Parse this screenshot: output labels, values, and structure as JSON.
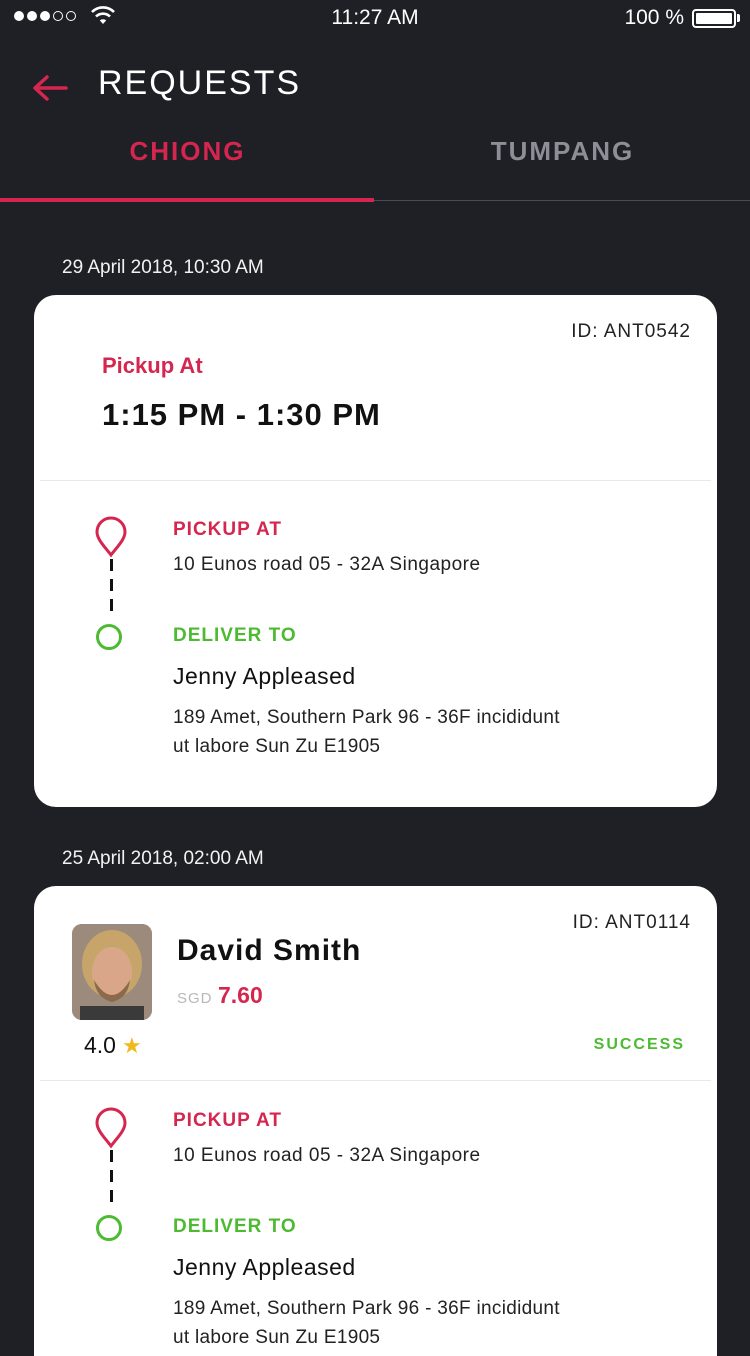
{
  "status_bar": {
    "time": "11:27 AM",
    "battery": "100 %"
  },
  "header": {
    "title": "REQUESTS"
  },
  "tabs": [
    {
      "label": "CHIONG",
      "active": true
    },
    {
      "label": "TUMPANG",
      "active": false
    }
  ],
  "requests": [
    {
      "date": "29 April 2018, 10:30 AM",
      "id": "ID: ANT0542",
      "pickup_time_label": "Pickup At",
      "pickup_time": "1:15 PM - 1:30 PM",
      "pickup_label": "PICKUP AT",
      "pickup_address": "10 Eunos road 05 - 32A Singapore",
      "deliver_label": "DELIVER TO",
      "recipient": "Jenny Appleased",
      "deliver_address_line1": "189 Amet, Southern Park 96 - 36F incididunt",
      "deliver_address_line2": "ut labore  Sun Zu E1905"
    },
    {
      "date": "25 April 2018, 02:00 AM",
      "id": "ID: ANT0114",
      "driver_name": "David Smith",
      "currency": "SGD",
      "amount": "7.60",
      "rating": "4.0",
      "status": "SUCCESS",
      "pickup_label": "PICKUP AT",
      "pickup_address": "10 Eunos road 05 - 32A Singapore",
      "deliver_label": "DELIVER TO",
      "recipient": "Jenny Appleased",
      "deliver_address_line1": "189 Amet, Southern Park 96 - 36F incididunt",
      "deliver_address_line2": "ut labore  Sun Zu E1905"
    }
  ],
  "colors": {
    "accent": "#d5264f",
    "success": "#4cbb31",
    "background": "#1f2026",
    "star": "#f0b91c"
  }
}
